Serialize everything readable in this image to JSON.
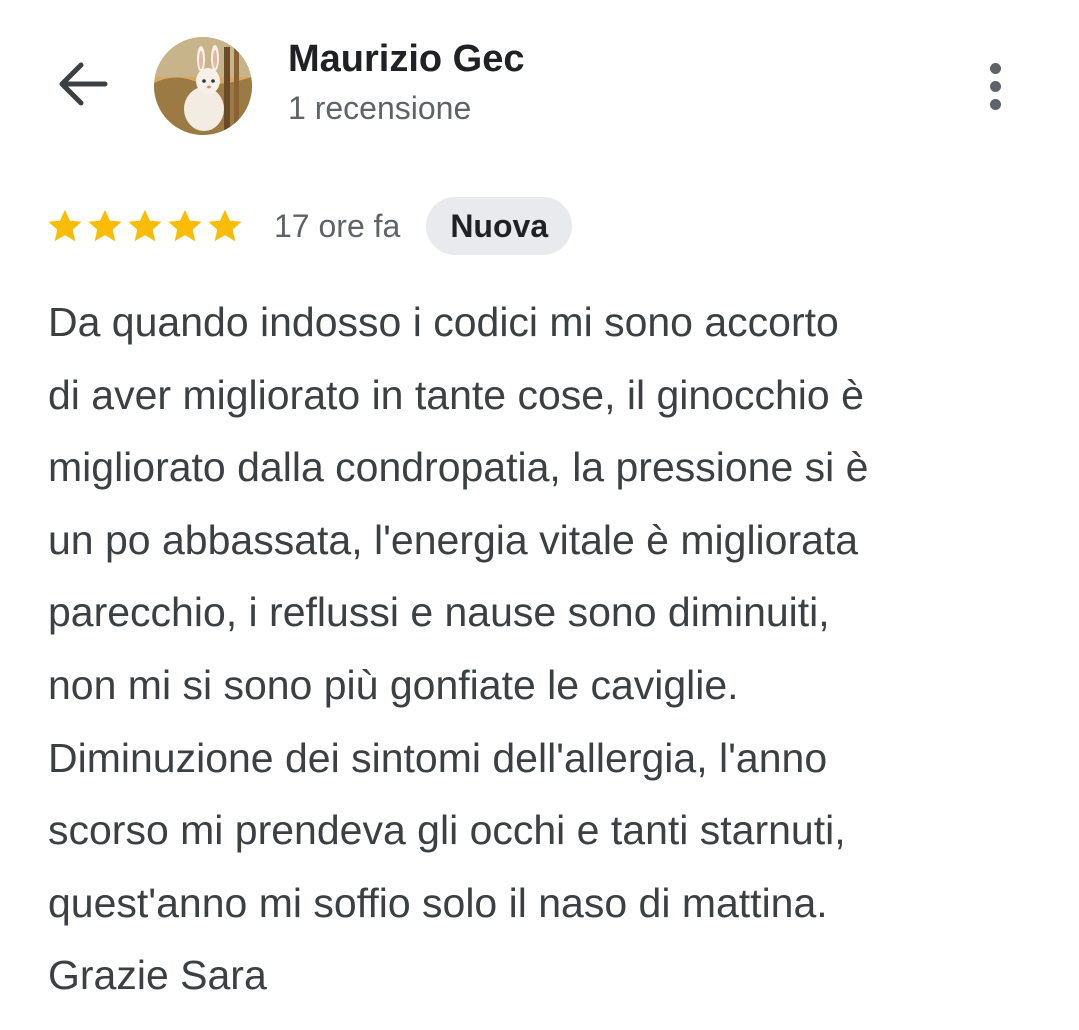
{
  "header": {
    "back_icon": "arrow-back-icon",
    "avatar_icon": "rabbit-avatar",
    "name": "Maurizio Gec",
    "subtitle": "1 recensione",
    "menu_icon": "more-vertical-icon"
  },
  "review": {
    "rating": 5,
    "max_rating": 5,
    "star_color": "#fbbc04",
    "time": "17 ore fa",
    "badge": "Nuova",
    "lines": [
      "Da quando indosso i codici mi sono accorto",
      "di aver migliorato in tante cose, il ginocchio è",
      "migliorato dalla condropatia, la pressione si è",
      "un po abbassata, l'energia vitale è migliorata",
      "parecchio, i reflussi e nause sono diminuiti,",
      "non mi si sono più gonfiate le caviglie.",
      "Diminuzione dei sintomi dell'allergia, l'anno",
      "scorso mi prendeva gli occhi e tanti starnuti,",
      "quest'anno mi soffio solo il naso di mattina.",
      "Grazie Sara"
    ]
  }
}
